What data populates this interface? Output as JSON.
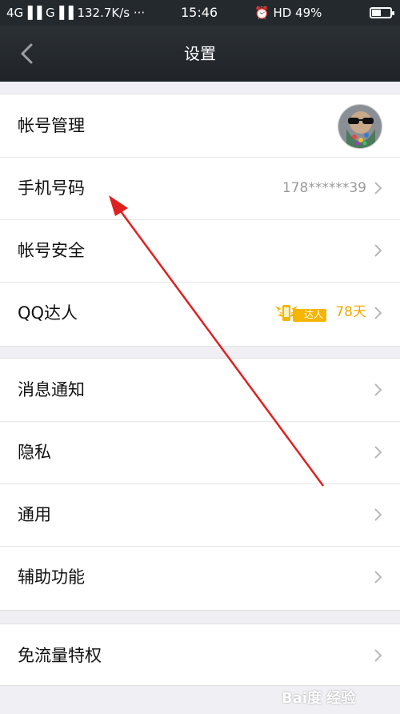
{
  "status_bar": {
    "left": "4G▐▐ G▐▐ 132.7K/s ···",
    "time": "15:46",
    "right": "⏰ HD 49%",
    "battery_level": 0.49
  },
  "nav": {
    "title": "设置"
  },
  "group1": {
    "account": {
      "label": "帐号管理"
    },
    "phone": {
      "label": "手机号码",
      "value": "178******39"
    },
    "security": {
      "label": "帐号安全"
    },
    "qq_talent": {
      "label": "QQ达人",
      "badge_text": "达人",
      "days": "78天"
    }
  },
  "group2": {
    "notifications": {
      "label": "消息通知"
    },
    "privacy": {
      "label": "隐私"
    },
    "general": {
      "label": "通用"
    },
    "accessibility": {
      "label": "辅助功能"
    }
  },
  "group3": {
    "free_data": {
      "label": "免流量特权"
    }
  },
  "watermark": {
    "text": "Bai度 经验"
  },
  "colors": {
    "nav_bg": "#24292e",
    "page_bg": "#efeff4",
    "accent_gold": "#f0a800",
    "annotation_red": "#e02020"
  }
}
